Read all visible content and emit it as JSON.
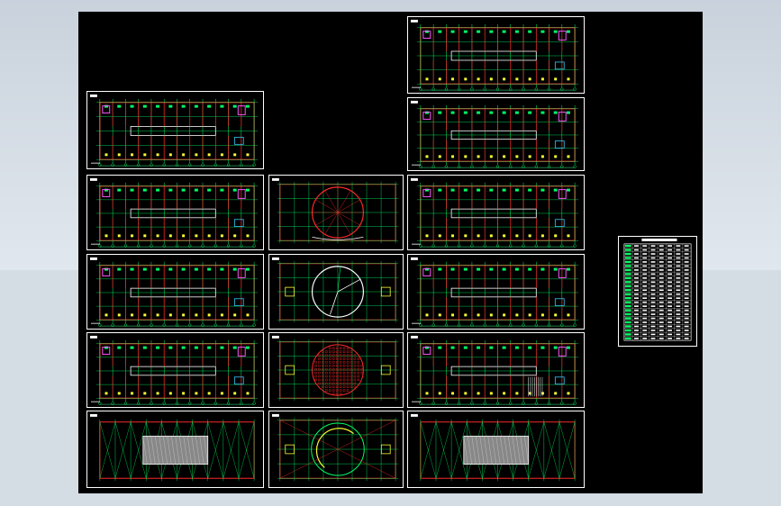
{
  "window": {
    "background": "#d4dce4",
    "canvas_color": "#000000"
  },
  "colors": {
    "border": "#ffffff",
    "wall": "#ff2a2a",
    "grid": "#00ff66",
    "dim": "#33ff88",
    "accent": "#ff55ff",
    "detail": "#ffffff",
    "yellow": "#ffff33",
    "cyan": "#33ccff"
  },
  "sheets": [
    {
      "id": "sheet-r0-c2",
      "kind": "plan"
    },
    {
      "id": "sheet-r1-c0",
      "kind": "plan"
    },
    {
      "id": "sheet-r1-c2",
      "kind": "plan"
    },
    {
      "id": "sheet-r2-c0",
      "kind": "plan"
    },
    {
      "id": "sheet-r2-c1",
      "kind": "round-a"
    },
    {
      "id": "sheet-r2-c2",
      "kind": "plan"
    },
    {
      "id": "sheet-r3-c0",
      "kind": "plan"
    },
    {
      "id": "sheet-r3-c1",
      "kind": "round-b"
    },
    {
      "id": "sheet-r3-c2",
      "kind": "plan"
    },
    {
      "id": "sheet-r4-c0",
      "kind": "plan"
    },
    {
      "id": "sheet-r4-c1",
      "kind": "round-c"
    },
    {
      "id": "sheet-r4-c2",
      "kind": "plan-stair"
    },
    {
      "id": "sheet-r5-c0",
      "kind": "roof"
    },
    {
      "id": "sheet-r5-c1",
      "kind": "round-d"
    },
    {
      "id": "sheet-r5-c2",
      "kind": "roof"
    }
  ],
  "legend_table": {
    "rows": 24,
    "cols": 8
  }
}
